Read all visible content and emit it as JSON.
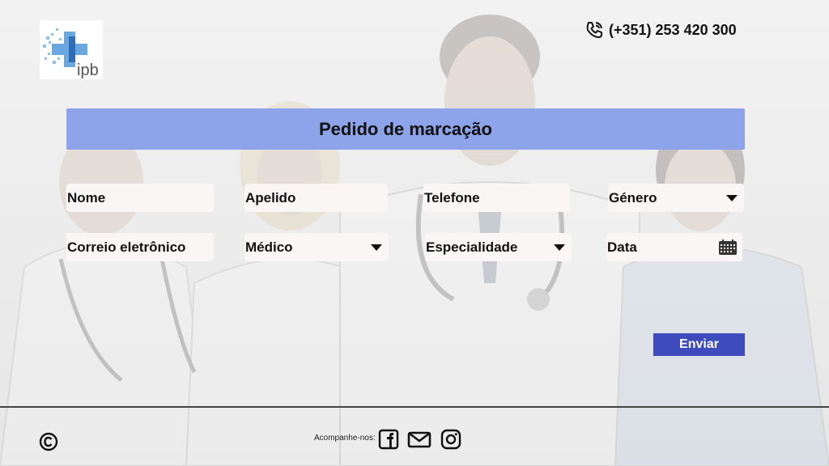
{
  "header": {
    "logo_text": "ipb",
    "phone": "(+351) 253 420 300"
  },
  "form": {
    "title": "Pedido de marcação",
    "fields": {
      "nome": "Nome",
      "apelido": "Apelido",
      "telefone": "Telefone",
      "genero": "Género",
      "email": "Correio eletrônico",
      "medico": "Médico",
      "especialidade": "Especialidade",
      "data": "Data"
    },
    "submit_label": "Enviar"
  },
  "footer": {
    "follow_label": "Acompanhe-nos:",
    "social_icons": [
      "facebook-icon",
      "mail-icon",
      "instagram-icon"
    ]
  },
  "colors": {
    "title_bar": "#8ea4ea",
    "submit_button": "#3e4bbd",
    "field_bg": "#fbf6f6"
  }
}
